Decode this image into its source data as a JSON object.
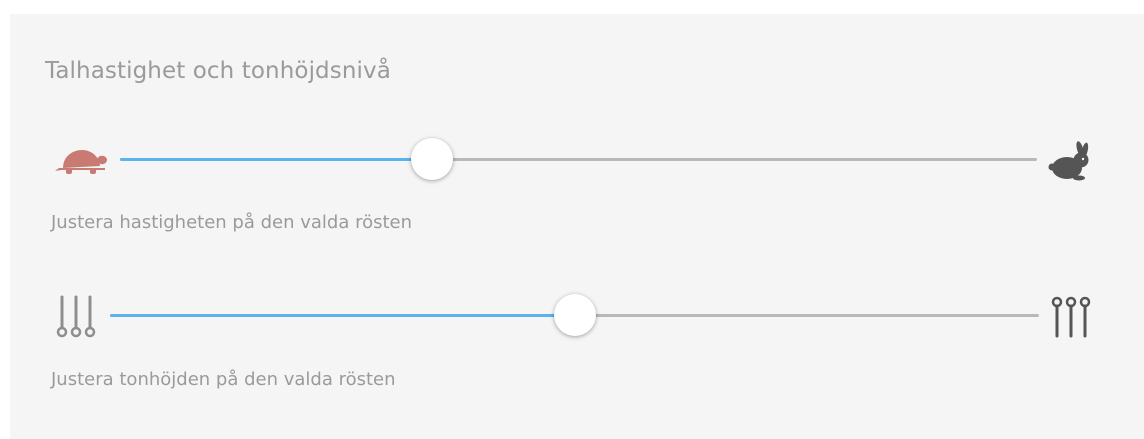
{
  "section": {
    "title": "Talhastighet och tonhöjdsnivå"
  },
  "speed": {
    "caption": "Justera hastigheten på den valda rösten",
    "value": 0.34,
    "left_icon": "turtle-icon",
    "right_icon": "rabbit-icon"
  },
  "pitch": {
    "caption": "Justera tonhöjden på den valda rösten",
    "value": 0.5,
    "left_icon": "pitch-low-icon",
    "right_icon": "pitch-high-icon"
  },
  "colors": {
    "accent": "#5ab2ef",
    "track": "#b9b9b9",
    "turtle": "#c97b73",
    "rabbit": "#555555",
    "text": "#9a9a9a"
  }
}
